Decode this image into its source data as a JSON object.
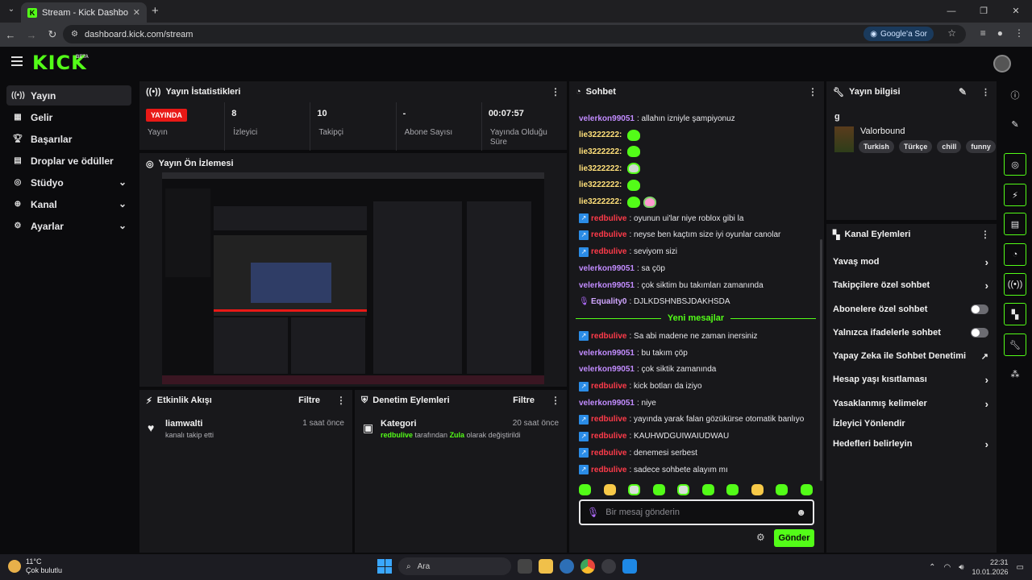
{
  "browser": {
    "tab_title": "Stream - Kick Dashboard",
    "tab_favicon": "K",
    "url": "dashboard.kick.com/stream",
    "google_sor": "Google'a Sor"
  },
  "header": {
    "logo": "KICK",
    "beta": "BETA"
  },
  "sidebar": {
    "items": [
      {
        "label": "Yayın",
        "icon": "broadcast-icon"
      },
      {
        "label": "Gelir",
        "icon": "revenue-icon"
      },
      {
        "label": "Başarılar",
        "icon": "trophy-icon"
      },
      {
        "label": "Droplar ve ödüller",
        "icon": "gift-icon"
      },
      {
        "label": "Stüdyo",
        "icon": "studio-icon"
      },
      {
        "label": "Kanal",
        "icon": "channel-icon"
      },
      {
        "label": "Ayarlar",
        "icon": "settings-icon"
      }
    ]
  },
  "stats": {
    "title": "Yayın İstatistikleri",
    "live_badge": "YAYINDA",
    "live_label": "Yayın",
    "viewers_value": "8",
    "viewers_label": "İzleyici",
    "followers_value": "10",
    "followers_label": "Takipçi",
    "subs_value": "-",
    "subs_label": "Abone Sayısı",
    "uptime_value": "00:07:57",
    "uptime_label": "Yayında Olduğu Süre"
  },
  "preview": {
    "title": "Yayın Ön İzlemesi"
  },
  "activity": {
    "title": "Etkinlik Akışı",
    "filter": "Filtre",
    "item_user": "liamwalti",
    "item_sub": "kanalı takip etti",
    "item_time": "1 saat önce"
  },
  "moderation": {
    "title": "Denetim Eylemleri",
    "filter": "Filtre",
    "item_title": "Kategori",
    "item_user": "redbulive",
    "item_mid": " tarafından ",
    "item_game": "Zula",
    "item_end": " olarak değiştirildi",
    "item_time": "20 saat önce"
  },
  "chat": {
    "title": "Sohbet",
    "messages": [
      {
        "user": "velerkon99051",
        "text": ": allahın izniyle şampiyonuz",
        "color": "purple"
      },
      {
        "user": "lie3222222:",
        "text": "",
        "color": "yellow",
        "emotes": 1
      },
      {
        "user": "lie3222222:",
        "text": "",
        "color": "yellow",
        "emotes": 1
      },
      {
        "user": "lie3222222:",
        "text": "",
        "color": "yellow",
        "emotes": 1
      },
      {
        "user": "lie3222222:",
        "text": "",
        "color": "yellow",
        "emotes": 1
      },
      {
        "user": "lie3222222:",
        "text": "",
        "color": "yellow",
        "emotes": 2
      },
      {
        "user": "redbulive",
        "text": ": oyunun ui'lar niye roblox gibi la",
        "color": "red"
      },
      {
        "user": "redbulive",
        "text": ": neyse ben kaçtım size iyi oyunlar canolar",
        "color": "red"
      },
      {
        "user": "redbulive",
        "text": ": seviyom sizi",
        "color": "red"
      },
      {
        "user": "velerkon99051",
        "text": ": sa çöp",
        "color": "purple"
      },
      {
        "user": "velerkon99051",
        "text": ": çok siktim bu takımları zamanında",
        "color": "purple"
      },
      {
        "user": "Equality0",
        "text": ": DJLKDSHNBSJDAKHSDA",
        "color": "violet"
      }
    ],
    "new_messages": "Yeni mesajlar",
    "messages2": [
      {
        "user": "redbulive",
        "text": ": Sa abi madene ne zaman inersiniz",
        "color": "red"
      },
      {
        "user": "velerkon99051",
        "text": ": bu takım çöp",
        "color": "purple"
      },
      {
        "user": "velerkon99051",
        "text": ": çok siktik zamanında",
        "color": "purple"
      },
      {
        "user": "redbulive",
        "text": ": kick botları da iziyo",
        "color": "red"
      },
      {
        "user": "velerkon99051",
        "text": ": niye",
        "color": "purple"
      },
      {
        "user": "redbulive",
        "text": ": yayında yarak falan gözükürse otomatik banlıyo",
        "color": "red"
      },
      {
        "user": "redbulive",
        "text": ": KAUHWDGUIWAIUDWAU",
        "color": "red"
      },
      {
        "user": "redbulive",
        "text": ": denemesi serbest",
        "color": "red"
      },
      {
        "user": "redbulive",
        "text": ": sadece sohbete alayım mı",
        "color": "red"
      }
    ],
    "input_placeholder": "Bir mesaj gönderin",
    "send": "Gönder"
  },
  "info": {
    "title": "Yayın bilgisi",
    "stream_title": "g",
    "game": "Valorbound",
    "tags": [
      "Turkish",
      "Türkçe",
      "chill",
      "funny"
    ]
  },
  "channel_actions": {
    "title": "Kanal Eylemleri",
    "items": [
      {
        "label": "Yavaş mod",
        "kind": "arrow"
      },
      {
        "label": "Takipçilere özel sohbet",
        "kind": "arrow"
      },
      {
        "label": "Abonelere özel sohbet",
        "kind": "toggle"
      },
      {
        "label": "Yalnızca ifadelerle sohbet",
        "kind": "toggle"
      },
      {
        "label": "Yapay Zeka ile Sohbet Denetimi",
        "kind": "external"
      },
      {
        "label": "Hesap yaşı kısıtlaması",
        "kind": "arrow"
      },
      {
        "label": "Yasaklanmış kelimeler",
        "kind": "arrow"
      },
      {
        "label": "İzleyici Yönlendir",
        "kind": "none"
      },
      {
        "label": "Hedefleri belirleyin",
        "kind": "arrow"
      }
    ]
  },
  "taskbar": {
    "temp": "11°C",
    "weather": "Çok bulutlu",
    "search": "Ara",
    "time": "22:31",
    "date": "10.01.2026"
  },
  "colors": {
    "accent": "#53fc18",
    "live": "#e91916",
    "panel": "#18181b"
  }
}
